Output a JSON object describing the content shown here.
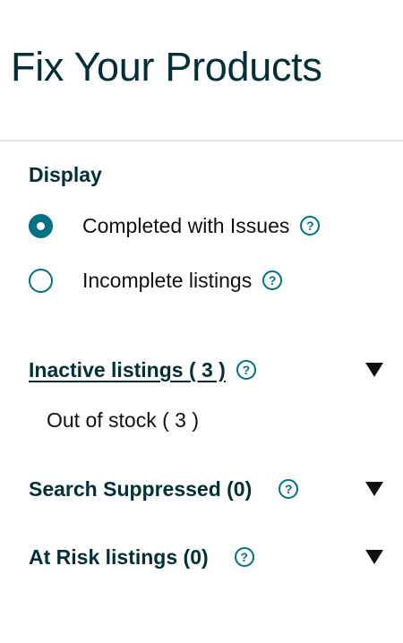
{
  "page": {
    "title": "Fix Your Products"
  },
  "display": {
    "label": "Display",
    "options": [
      {
        "label": "Completed with Issues",
        "selected": true
      },
      {
        "label": "Incomplete listings",
        "selected": false
      }
    ]
  },
  "groups": [
    {
      "title": "Inactive listings ( 3 ) ",
      "linked": true,
      "expanded": true,
      "items": [
        {
          "label": "Out of stock ( 3 )"
        }
      ]
    },
    {
      "title": "Search Suppressed (0)",
      "linked": false,
      "expanded": false
    },
    {
      "title": "At Risk listings (0)",
      "linked": false,
      "expanded": false
    }
  ],
  "icons": {
    "help": "question-mark-circle-icon",
    "toggle": "triangle-down-icon",
    "help_glyph": "?"
  },
  "colors": {
    "accent": "#007185",
    "heading": "#002f36",
    "text": "#0f1111",
    "divider": "#e3e6e6"
  }
}
